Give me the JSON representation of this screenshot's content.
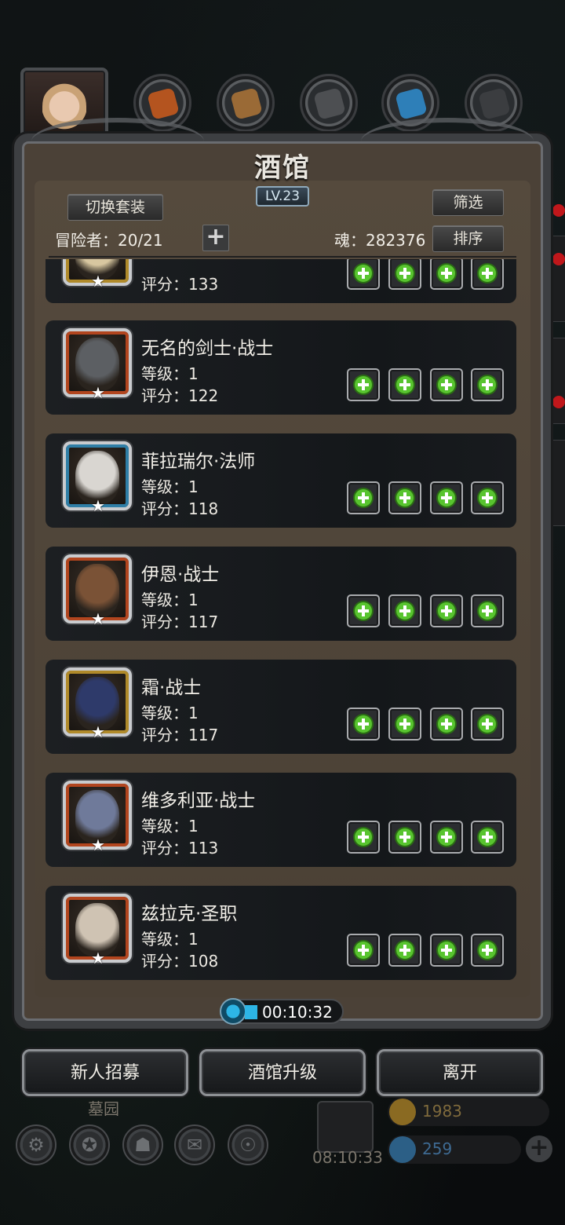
{
  "panel": {
    "title": "酒馆",
    "level_badge": "LV.23",
    "switch_outfit_label": "切换套装",
    "filter_label": "筛选",
    "sort_label": "排序",
    "adventurers_text": "冒险者：20/21",
    "soul_text": "魂：282376"
  },
  "heroes": [
    {
      "name": "",
      "level_text": "",
      "score_text": "评分：133",
      "frame": "#b08a2a",
      "face": "#d8c7a0"
    },
    {
      "name": "无名的剑士·战士",
      "level_text": "等级：1",
      "score_text": "评分：122",
      "frame": "#b2451e",
      "face": "#5c5f63"
    },
    {
      "name": "菲拉瑞尔·法师",
      "level_text": "等级：1",
      "score_text": "评分：118",
      "frame": "#2f7ea6",
      "face": "#d9d6d1"
    },
    {
      "name": "伊恩·战士",
      "level_text": "等级：1",
      "score_text": "评分：117",
      "frame": "#b2451e",
      "face": "#7a5236"
    },
    {
      "name": "霜·战士",
      "level_text": "等级：1",
      "score_text": "评分：117",
      "frame": "#b08a2a",
      "face": "#2e3a6a"
    },
    {
      "name": "维多利亚·战士",
      "level_text": "等级：1",
      "score_text": "评分：113",
      "frame": "#b2451e",
      "face": "#6f7a9a"
    },
    {
      "name": "兹拉克·圣职",
      "level_text": "等级：1",
      "score_text": "评分：108",
      "frame": "#b2451e",
      "face": "#cfc3b3"
    }
  ],
  "timer": {
    "text": "00:10:32"
  },
  "buttons": {
    "recruit": "新人招募",
    "upgrade": "酒馆升级",
    "leave": "离开"
  },
  "dock": {
    "location_label": "墓园",
    "gift_timer": "08:10:33",
    "gold": "1983",
    "gems": "259"
  },
  "colors": {
    "slot_plus": "#58c42f",
    "timer_accent": "#2db5e6",
    "badge_red": "#c0171b"
  }
}
